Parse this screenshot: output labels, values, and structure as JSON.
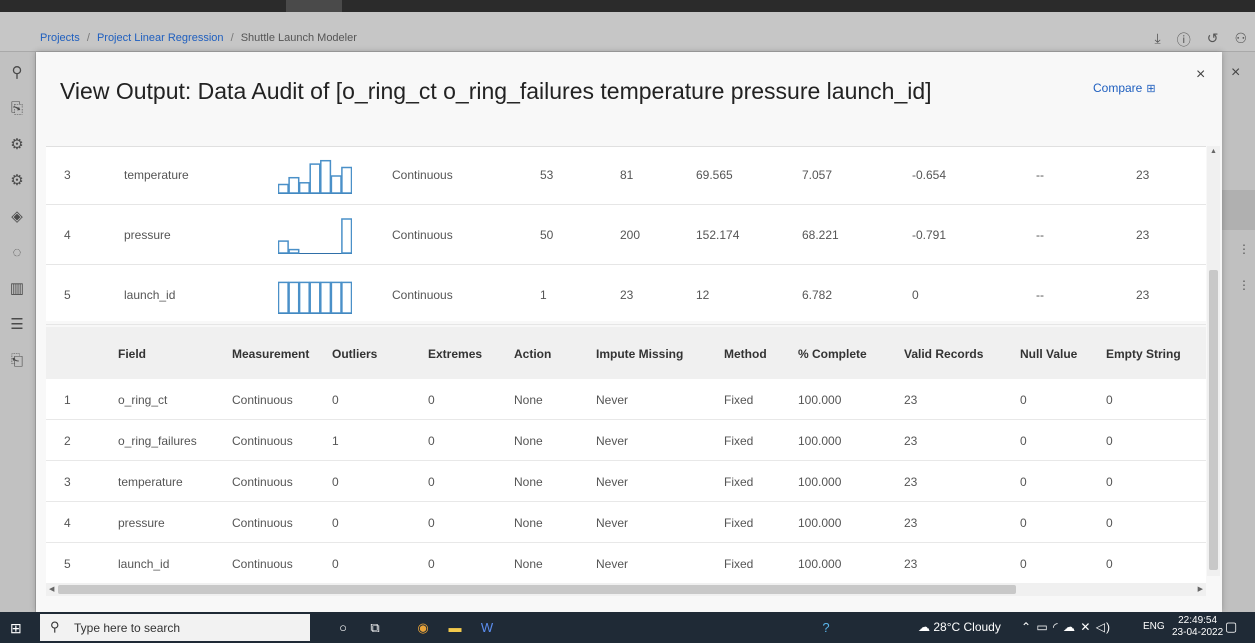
{
  "breadcrumb": {
    "item1": "Projects",
    "sep1": "/",
    "item2": "Project Linear Regression",
    "sep2": "/",
    "item3": "Shuttle Launch Modeler"
  },
  "modal": {
    "title": "View Output: Data Audit of [o_ring_ct o_ring_failures temperature pressure launch_id]",
    "compare_label": "Compare",
    "close": "×"
  },
  "outer_close": "×",
  "audit_rows": [
    {
      "no": "3",
      "field": "temperature",
      "measurement": "Continuous",
      "min": "53",
      "max": "81",
      "mean": "69.565",
      "std": "7.057",
      "skew": "-0.654",
      "unique": "--",
      "valid": "23",
      "hist": [
        0.25,
        0.45,
        0.3,
        0.85,
        0.95,
        0.5,
        0.75
      ]
    },
    {
      "no": "4",
      "field": "pressure",
      "measurement": "Continuous",
      "min": "50",
      "max": "200",
      "mean": "152.174",
      "std": "68.221",
      "skew": "-0.791",
      "unique": "--",
      "valid": "23",
      "hist": [
        0.35,
        0.1,
        0.0,
        0.0,
        0.0,
        0.0,
        1.0
      ]
    },
    {
      "no": "5",
      "field": "launch_id",
      "measurement": "Continuous",
      "min": "1",
      "max": "23",
      "mean": "12",
      "std": "6.782",
      "skew": "0",
      "unique": "--",
      "valid": "23",
      "hist": [
        0.9,
        0.9,
        0.9,
        0.9,
        0.9,
        0.9,
        0.9
      ]
    }
  ],
  "quality_table": {
    "headers": [
      "Field",
      "Measurement",
      "Outliers",
      "Extremes",
      "Action",
      "Impute Missing",
      "Method",
      "% Complete",
      "Valid Records",
      "Null Value",
      "Empty String"
    ],
    "rows": [
      {
        "no": "1",
        "cells": [
          "o_ring_ct",
          "Continuous",
          "0",
          "0",
          "None",
          "Never",
          "Fixed",
          "100.000",
          "23",
          "0",
          "0"
        ]
      },
      {
        "no": "2",
        "cells": [
          "o_ring_failures",
          "Continuous",
          "1",
          "0",
          "None",
          "Never",
          "Fixed",
          "100.000",
          "23",
          "0",
          "0"
        ]
      },
      {
        "no": "3",
        "cells": [
          "temperature",
          "Continuous",
          "0",
          "0",
          "None",
          "Never",
          "Fixed",
          "100.000",
          "23",
          "0",
          "0"
        ]
      },
      {
        "no": "4",
        "cells": [
          "pressure",
          "Continuous",
          "0",
          "0",
          "None",
          "Never",
          "Fixed",
          "100.000",
          "23",
          "0",
          "0"
        ]
      },
      {
        "no": "5",
        "cells": [
          "launch_id",
          "Continuous",
          "0",
          "0",
          "None",
          "Never",
          "Fixed",
          "100.000",
          "23",
          "0",
          "0"
        ]
      }
    ]
  },
  "taskbar": {
    "search_placeholder": "Type here to search",
    "weather": "28°C Cloudy",
    "lang": "ENG",
    "time": "22:49:54",
    "date": "23-04-2022"
  },
  "colors": {
    "link": "#1f5fbf",
    "hist_bar": "#4a90c8"
  },
  "icons": [
    "search-icon",
    "download-icon",
    "info-icon",
    "history-icon",
    "compare-icon",
    "close-icon",
    "windows-start-icon",
    "cortana-icon",
    "task-view-icon",
    "chrome-icon",
    "file-explorer-icon",
    "word-icon",
    "weather-icon",
    "notification-icon"
  ]
}
